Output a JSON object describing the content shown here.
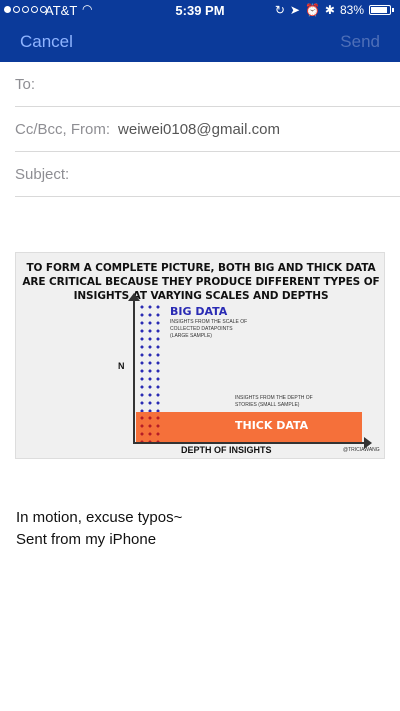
{
  "status": {
    "carrier": "AT&T",
    "time": "5:39 PM",
    "battery": "83%"
  },
  "nav": {
    "cancel": "Cancel",
    "send": "Send"
  },
  "fields": {
    "to_label": "To:",
    "cc_label": "Cc/Bcc, From:",
    "from_email": "weiwei0108@gmail.com",
    "subject_label": "Subject:"
  },
  "image": {
    "title": "TO FORM A COMPLETE PICTURE, BOTH BIG AND THICK DATA ARE CRITICAL BECAUSE THEY PRODUCE DIFFERENT TYPES OF INSIGHTS AT VARYING SCALES AND DEPTHS",
    "big_title": "BIG DATA",
    "big_desc": "INSIGHTS FROM THE SCALE OF COLLECTED DATAPOINTS (LARGE SAMPLE)",
    "thick_title": "THICK DATA",
    "thick_desc": "INSIGHTS FROM THE DEPTH OF STORIES (SMALL SAMPLE)",
    "y_axis": "N",
    "x_axis": "DEPTH OF INSIGHTS",
    "credit": "@TRICIAWANG"
  },
  "body": {
    "line1": "In motion, excuse typos~",
    "line2": "Sent from my iPhone"
  }
}
